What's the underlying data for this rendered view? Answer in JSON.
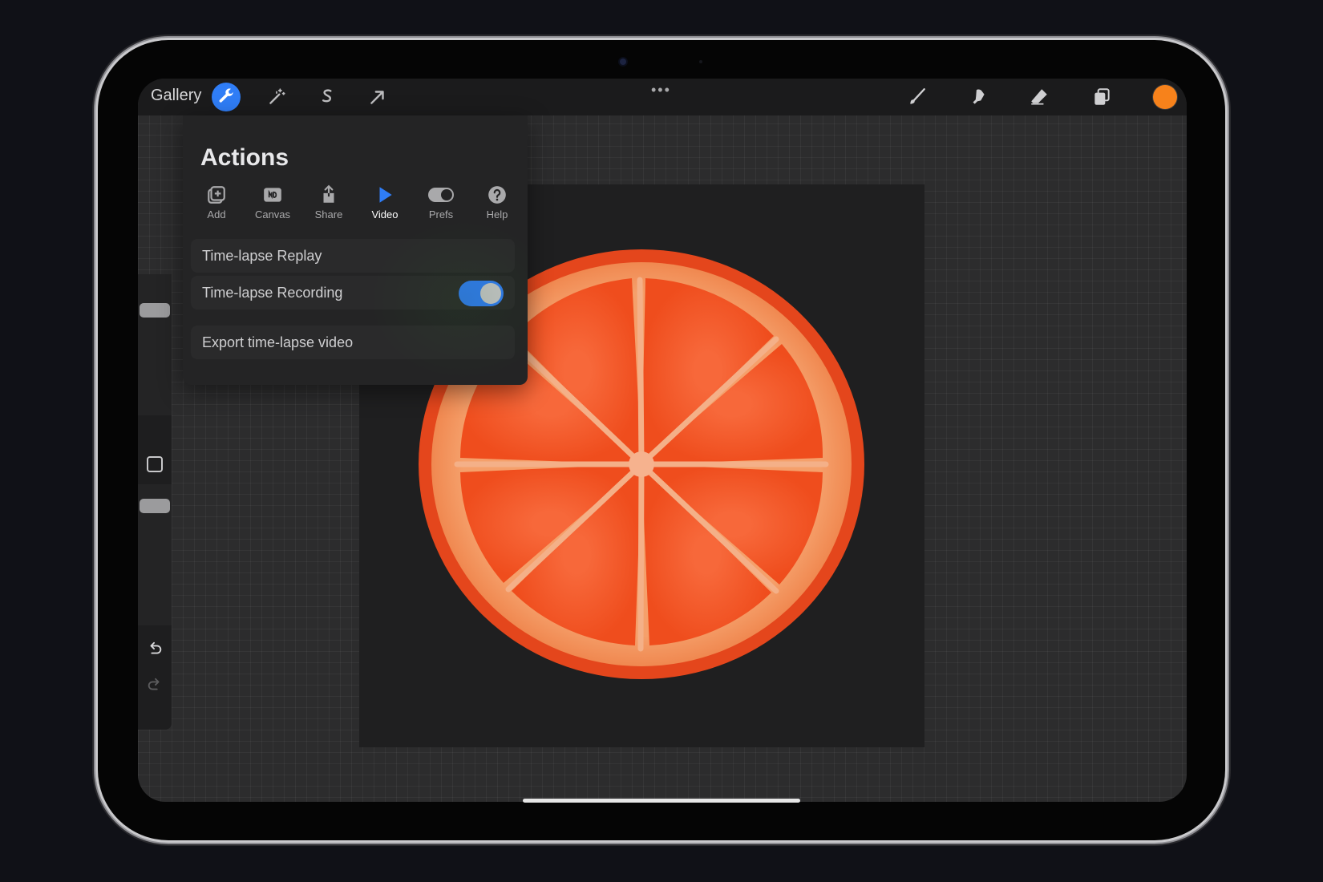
{
  "toolbar": {
    "gallery_label": "Gallery",
    "more_label": "•••",
    "brand_color": "#2f7df6",
    "current_color": "#f7821b"
  },
  "actions": {
    "title": "Actions",
    "tabs": [
      {
        "label": "Add",
        "icon": "add-icon"
      },
      {
        "label": "Canvas",
        "icon": "canvas-icon"
      },
      {
        "label": "Share",
        "icon": "share-icon"
      },
      {
        "label": "Video",
        "icon": "play-icon",
        "active": true
      },
      {
        "label": "Prefs",
        "icon": "toggle-icon"
      },
      {
        "label": "Help",
        "icon": "help-icon"
      }
    ],
    "items": {
      "replay": "Time-lapse Replay",
      "recording": "Time-lapse Recording",
      "recording_on": true,
      "export": "Export time-lapse video"
    }
  }
}
